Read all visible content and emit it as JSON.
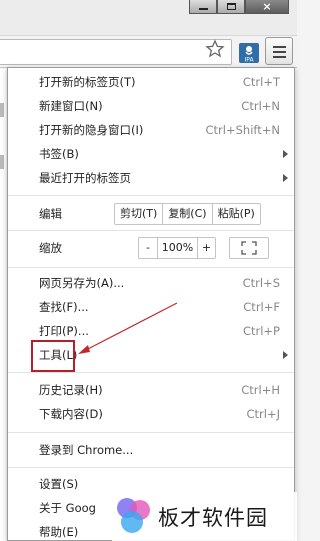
{
  "window": {
    "close_glyph": "×"
  },
  "toolbar": {
    "star_icon": "bookmark-star-icon",
    "extension_label": "IPA",
    "menu_icon": "hamburger-menu-icon"
  },
  "menu": {
    "items_top": [
      {
        "label": "打开新的标签页(T)",
        "shortcut": "Ctrl+T"
      },
      {
        "label": "新建窗口(N)",
        "shortcut": "Ctrl+N"
      },
      {
        "label": "打开新的隐身窗口(I)",
        "shortcut": "Ctrl+Shift+N"
      },
      {
        "label": "书签(B)",
        "shortcut": ""
      },
      {
        "label": "最近打开的标签页",
        "shortcut": ""
      }
    ],
    "edit": {
      "label": "编辑",
      "cut": "剪切(T)",
      "copy": "复制(C)",
      "paste": "粘贴(P)"
    },
    "zoom": {
      "label": "缩放",
      "minus": "-",
      "level": "100%",
      "plus": "+"
    },
    "items_mid": [
      {
        "label": "网页另存为(A)...",
        "shortcut": "Ctrl+S"
      },
      {
        "label": "查找(F)...",
        "shortcut": "Ctrl+F"
      },
      {
        "label": "打印(P)...",
        "shortcut": "Ctrl+P"
      },
      {
        "label": "工具(L)",
        "shortcut": ""
      }
    ],
    "items_history": [
      {
        "label": "历史记录(H)",
        "shortcut": "Ctrl+H"
      },
      {
        "label": "下载内容(D)",
        "shortcut": "Ctrl+J"
      }
    ],
    "signin": {
      "label": "登录到 Chrome..."
    },
    "items_bottom": [
      {
        "label": "设置(S)"
      },
      {
        "label": "关于 Goog"
      },
      {
        "label": "帮助(E)"
      }
    ]
  },
  "watermark": {
    "text": "板才软件园"
  },
  "colors": {
    "highlight": "#b4202a",
    "arrow": "#c0282e"
  }
}
